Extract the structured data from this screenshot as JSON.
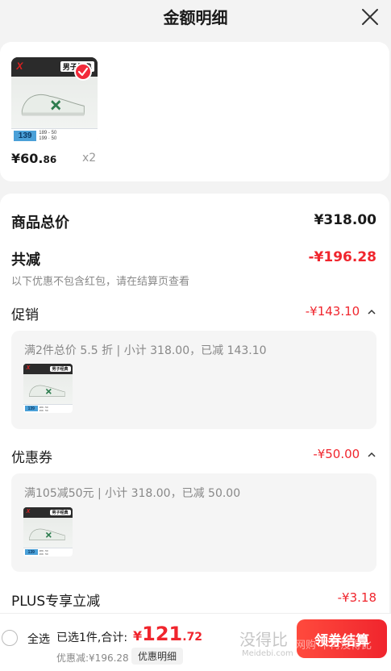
{
  "header": {
    "title": "金额明细"
  },
  "top_item": {
    "image": {
      "logo": "X",
      "tag": "男子经典",
      "badge_price": "139",
      "mini_line1": "189 - 50",
      "mini_line2": "199 · 50"
    },
    "price_symbol": "¥",
    "price_int": "60.",
    "price_dec": "86",
    "qty": "x2"
  },
  "summary": {
    "goods_total_label": "商品总价",
    "goods_total_value": "¥318.00",
    "reduce_label": "共减",
    "reduce_value": "-¥196.28",
    "note": "以下优惠不包含红包，请在结算页查看",
    "promotion": {
      "label": "促销",
      "value": "-¥143.10",
      "desc": "满2件总价 5.5 折 | 小计 318.00，已减 143.10",
      "image": {
        "logo": "X",
        "tag": "男子经典",
        "badge_price": "139",
        "mini_line1": "189 - 50",
        "mini_line2": "199 · 50"
      }
    },
    "coupon": {
      "label": "优惠券",
      "value": "-¥50.00",
      "desc": "满105减50元 | 小计 318.00，已减 50.00",
      "image": {
        "logo": "X",
        "tag": "男子经典",
        "badge_price": "139",
        "mini_line1": "189 - 50",
        "mini_line2": "199 · 50"
      }
    },
    "plus": {
      "label": "PLUS专享立减",
      "value": "-¥3.18"
    }
  },
  "bottom_bar": {
    "select_all": "全选",
    "selected": "已选1件,合计:",
    "total_symbol": "¥",
    "total_int": "121",
    "total_dec": ".72",
    "discount_line": "优惠减:¥196.28",
    "detail_button": "优惠明细",
    "watermark": "没得比",
    "watermark_sub": "Meidebi.com",
    "watermark_overlay": "网购 不再没得比",
    "checkout_button": "领券结算"
  },
  "colors": {
    "accent": "#f0252d",
    "background": "#f3f3f3"
  }
}
